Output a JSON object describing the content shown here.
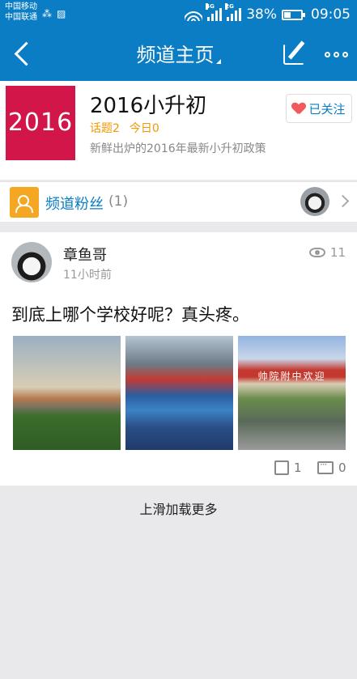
{
  "status_bar": {
    "carrier_1": "中国移动",
    "carrier_2": "中国联通",
    "battery": "38%",
    "time": "09:05",
    "net_1": "4G",
    "net_2": "2G",
    "battery_level": 0.38
  },
  "nav": {
    "title": "频道主页"
  },
  "channel": {
    "cover_text": "2016",
    "name": "2016小升初",
    "topics": "话题2",
    "today": "今日0",
    "description": "新鲜出炉的2016年最新小升初政策",
    "follow_label": "已关注"
  },
  "fans": {
    "label": "频道粉丝",
    "count": "(1)"
  },
  "post": {
    "author": "章鱼哥",
    "time": "11小时前",
    "views": "11",
    "text": "到底上哪个学校好呢？真头疼。",
    "image_3_banner": "帅院附中欢迎",
    "likes": "1",
    "comments": "0"
  },
  "load_more": "上滑加载更多",
  "colors": {
    "brand_blue": "#0a7dc4",
    "cover_red": "#d2164a",
    "stats_orange": "#f39800"
  }
}
